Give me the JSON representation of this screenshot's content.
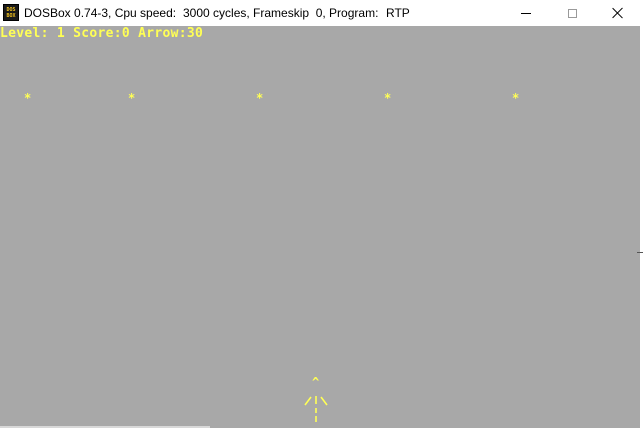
{
  "window": {
    "icon_line1": "DOS",
    "icon_line2": "BOX",
    "app": "DOSBox 0.74-3, Cpu speed:",
    "cycles": "3000 cycles, Frameskip  0, Program:",
    "program": "RTP",
    "icon": "dosbox-icon",
    "minimize_icon": "minimize-icon",
    "maximize_icon": "maximize-icon",
    "close_icon": "close-icon"
  },
  "game": {
    "status": "Level: 1 Score:0 Arrow:30",
    "targets": [
      "*",
      "*",
      "*",
      "*",
      "*"
    ],
    "arrow_head": "^",
    "colors": {
      "background": "#a8a8a8",
      "text": "#ffff55"
    }
  }
}
